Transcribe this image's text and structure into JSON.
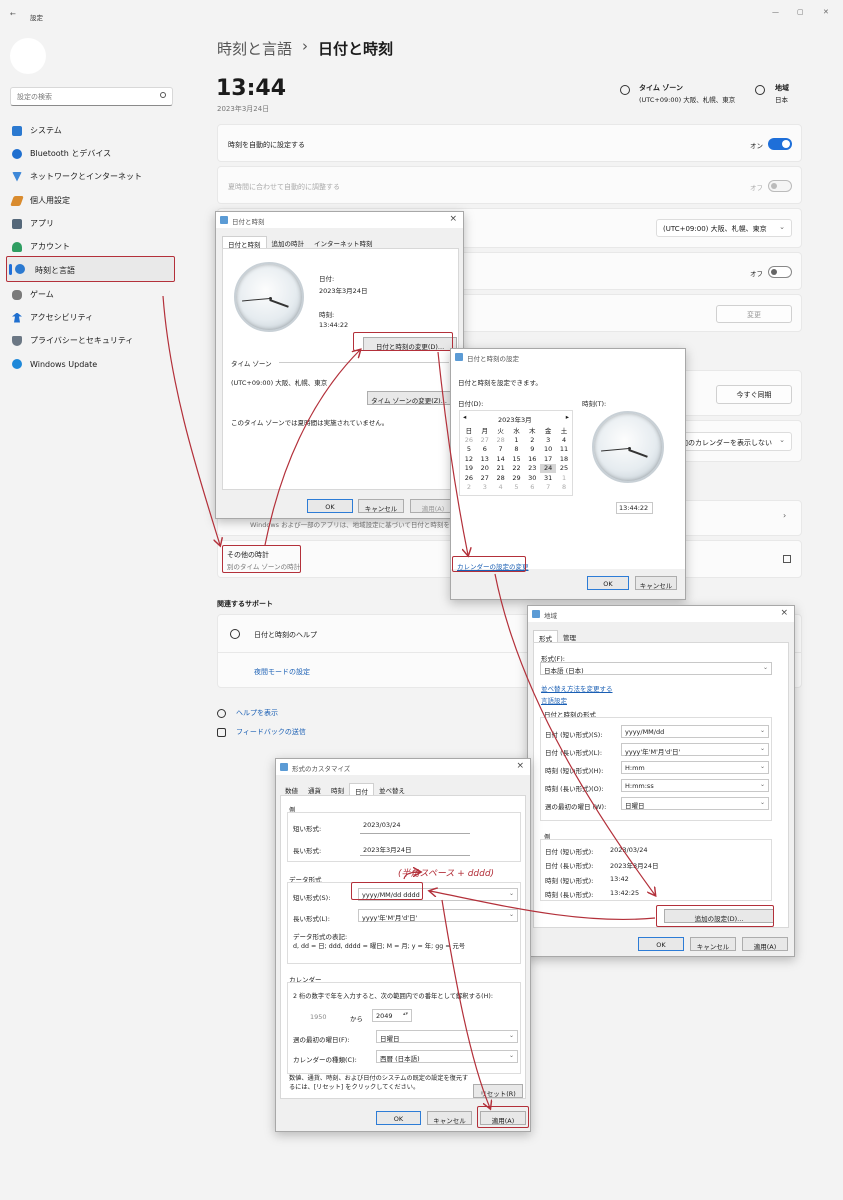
{
  "window": {
    "title": "設定",
    "back": "←",
    "minimize": "—",
    "maximize": "▢",
    "close": "✕"
  },
  "sidebar": {
    "search_placeholder": "設定の検索",
    "items": [
      {
        "label": "システム",
        "color": "#2b79d0"
      },
      {
        "label": "Bluetooth とデバイス",
        "color": "#1f6fcf"
      },
      {
        "label": "ネットワークとインターネット",
        "color": "#3e88d8"
      },
      {
        "label": "個人用設定",
        "color": "#d98b2e"
      },
      {
        "label": "アプリ",
        "color": "#55687a"
      },
      {
        "label": "アカウント",
        "color": "#2f9e62"
      },
      {
        "label": "時刻と言語",
        "color": "#2b79d0"
      },
      {
        "label": "ゲーム",
        "color": "#7a7a7a"
      },
      {
        "label": "アクセシビリティ",
        "color": "#1f6fcf"
      },
      {
        "label": "プライバシーとセキュリティ",
        "color": "#6b7784"
      },
      {
        "label": "Windows Update",
        "color": "#1e88d9"
      }
    ]
  },
  "header": {
    "crumb1": "時刻と言語",
    "crumb2": "日付と時刻",
    "sep": "›"
  },
  "clock_summary": {
    "time": "13:44",
    "date": "2023年3月24日",
    "tz_title": "タイム ゾーン",
    "tz_value": "(UTC+09:00) 大阪、札幌、東京",
    "region_title": "地域",
    "region_value": "日本"
  },
  "settings": {
    "auto_time": "時刻を自動的に設定する",
    "auto_time_state": "オン",
    "dst": "夏時間に合わせて自動的に調整する",
    "dst_state": "オフ",
    "tz_combo": "(UTC+09:00) 大阪、札幌、東京",
    "off_state": "オフ",
    "change": "変更",
    "sync_now": "今すぐ同期",
    "calendar_combo": "加のカレンダーを表示しない",
    "note": "Windows および一部のアプリは、地域設定に基づいて日付と時刻を書",
    "other_clocks": "その他の時計",
    "other_clocks_sub": "別のタイム ゾーンの時計"
  },
  "support": {
    "title": "関連するサポート",
    "help": "日付と時刻のヘルプ",
    "night": "夜間モードの設定"
  },
  "footer": {
    "help": "ヘルプを表示",
    "feedback": "フィードバックの送信"
  },
  "dlg_datetime": {
    "title": "日付と時刻",
    "tabs": [
      "日付と時刻",
      "追加の時計",
      "インターネット時刻"
    ],
    "date_label": "日付:",
    "date_value": "2023年3月24日",
    "time_label": "時刻:",
    "time_value": "13:44:22",
    "change_btn": "日付と時刻の変更(D)...",
    "tz_section": "タイム ゾーン",
    "tz_value": "(UTC+09:00) 大阪、札幌、東京",
    "tz_btn": "タイム ゾーンの変更(Z)...",
    "dst_note": "このタイム ゾーンでは夏時間は実施されていません。",
    "ok": "OK",
    "cancel": "キャンセル",
    "apply": "適用(A)"
  },
  "dlg_set": {
    "title": "日付と時刻の設定",
    "desc": "日付と時刻を設定できます。",
    "date_label": "日付(D):",
    "time_label": "時刻(T):",
    "month": "2023年3月",
    "weekdays": [
      "日",
      "月",
      "火",
      "水",
      "木",
      "金",
      "土"
    ],
    "weeks": [
      [
        "26",
        "27",
        "28",
        "1",
        "2",
        "3",
        "4"
      ],
      [
        "5",
        "6",
        "7",
        "8",
        "9",
        "10",
        "11"
      ],
      [
        "12",
        "13",
        "14",
        "15",
        "16",
        "17",
        "18"
      ],
      [
        "19",
        "20",
        "21",
        "22",
        "23",
        "24",
        "25"
      ],
      [
        "26",
        "27",
        "28",
        "29",
        "30",
        "31",
        "1"
      ],
      [
        "2",
        "3",
        "4",
        "5",
        "6",
        "7",
        "8"
      ]
    ],
    "time_value": "13:44:22",
    "calendar_link": "カレンダーの設定の変更",
    "ok": "OK",
    "cancel": "キャンセル"
  },
  "dlg_region": {
    "title": "地域",
    "tabs": [
      "形式",
      "管理"
    ],
    "format_label": "形式(F):",
    "format_value": "日本語 (日本)",
    "link1": "並べ替え方法を変更する",
    "link2": "言語設定",
    "group": "日付と時刻の形式",
    "rows": [
      {
        "label": "日付 (短い形式)(S):",
        "value": "yyyy/MM/dd"
      },
      {
        "label": "日付 (長い形式)(L):",
        "value": "yyyy'年'M'月'd'日'"
      },
      {
        "label": "時刻 (短い形式)(H):",
        "value": "H:mm"
      },
      {
        "label": "時刻 (長い形式)(O):",
        "value": "H:mm:ss"
      },
      {
        "label": "週の最初の曜日 (W):",
        "value": "日曜日"
      }
    ],
    "ex_title": "例",
    "examples": [
      {
        "label": "日付 (短い形式):",
        "value": "2023/03/24"
      },
      {
        "label": "日付 (長い形式):",
        "value": "2023年3月24日"
      },
      {
        "label": "時刻 (短い形式):",
        "value": "13:42"
      },
      {
        "label": "時刻 (長い形式):",
        "value": "13:42:25"
      }
    ],
    "extra_btn": "追加の設定(D)...",
    "ok": "OK",
    "cancel": "キャンセル",
    "apply": "適用(A)"
  },
  "dlg_custom": {
    "title": "形式のカスタマイズ",
    "tabs": [
      "数値",
      "通貨",
      "時刻",
      "日付",
      "並べ替え"
    ],
    "ex_title": "例",
    "short_label": "短い形式:",
    "short_value": "2023/03/24",
    "long_label": "長い形式:",
    "long_value": "2023年3月24日",
    "data_title": "データ形式",
    "short_fmt_label": "短い形式(S):",
    "short_fmt_value": "yyyy/MM/dd dddd",
    "long_fmt_label": "長い形式(L):",
    "long_fmt_value": "yyyy'年'M'月'd'日'",
    "notation_title": "データ形式の表記:",
    "notation": "d, dd = 日; ddd, dddd = 曜日; M = 月; y = 年; gg = 元号",
    "cal_title": "カレンダー",
    "cal_desc": "2 桁の数字で年を入力すると、次の範囲内での番年として解釈する(H):",
    "year_from": "1950",
    "year_to_label": "から",
    "year_to": "2049",
    "first_day_label": "週の最初の曜日(F):",
    "first_day_value": "日曜日",
    "cal_type_label": "カレンダーの種類(C):",
    "cal_type_value": "西暦 (日本語)",
    "reset_text": "数値、通貨、時刻、および日付のシステムの既定の設定を復元するには、[リセット] をクリックしてください。",
    "reset_btn": "リセット(R)",
    "ok": "OK",
    "cancel": "キャンセル",
    "apply": "適用(A)"
  },
  "annotation": {
    "text": "(半角スペース + dddd)",
    "color": "#b3303a"
  }
}
